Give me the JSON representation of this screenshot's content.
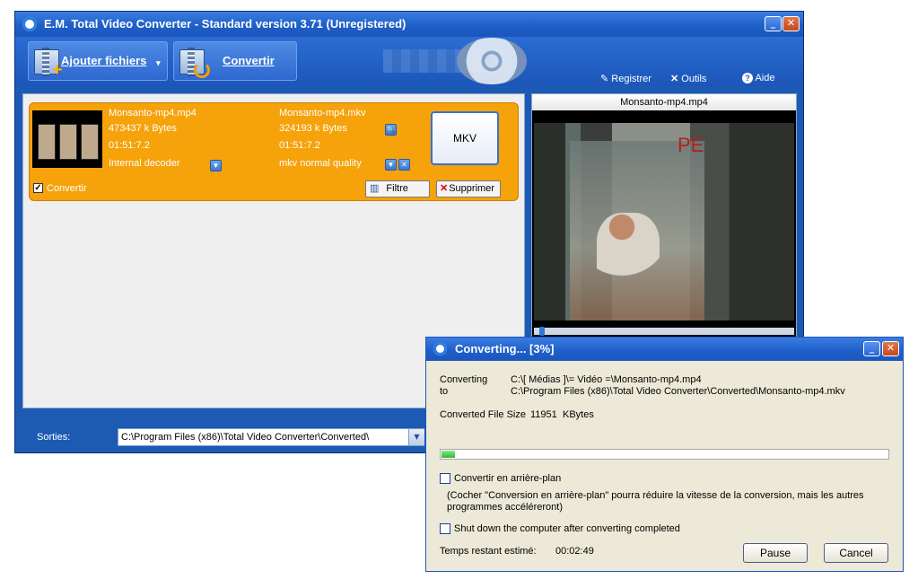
{
  "main_window": {
    "title": "E.M. Total Video Converter -  Standard version 3.71 (Unregistered)",
    "toolbar": {
      "add_files_label": "Ajouter fichiers",
      "add_files_arrow": "▾",
      "convert_label": "Convertir",
      "register_label": "Registrer",
      "tools_label": "Outils",
      "help_label": "Aide"
    },
    "file_item": {
      "source_name": "Monsanto-mp4.mp4",
      "source_size": "473437 k Bytes",
      "source_duration": "01:51:7.2",
      "source_decoder": "Internal decoder",
      "target_name": "Monsanto-mp4.mkv",
      "target_size": "324193 k Bytes",
      "target_duration": "01:51:7.2",
      "target_quality": "mkv normal quality",
      "format_button": "MKV",
      "convert_checkbox": "Convertir",
      "filter_button": "Filtre",
      "delete_button": "Supprimer"
    },
    "preview": {
      "title": "Monsanto-mp4.mp4",
      "frame_text": "PE",
      "position_fraction": 0.02
    },
    "output": {
      "label": "Sorties:",
      "path": "C:\\Program Files (x86)\\Total Video Converter\\Converted\\"
    }
  },
  "converting_dialog": {
    "title": "Converting... [3%]",
    "converting_label": "Converting",
    "to_label": "to",
    "source_path": "C:\\[ Médias ]\\= Vidéo =\\Monsanto-mp4.mp4",
    "target_path": "C:\\Program Files (x86)\\Total Video Converter\\Converted\\Monsanto-mp4.mkv",
    "file_size_label": "Converted File Size",
    "file_size_value": "11951",
    "file_size_unit": "KBytes",
    "progress_percent": 3,
    "background_checkbox": "Convertir en arrière-plan",
    "background_note": "(Cocher \"Conversion en arrière-plan\" pourra réduire la vitesse de la conversion, mais les autres programmes accéléreront)",
    "shutdown_checkbox": "Shut down the computer after converting completed",
    "time_left_label": "Temps restant estimé:",
    "time_left_value": "00:02:49",
    "pause_button": "Pause",
    "cancel_button": "Cancel"
  },
  "colors": {
    "window_blue": "#1d5ab4",
    "item_orange": "#f5a20b",
    "progress_green": "#2fb82f",
    "dialog_bg": "#ece9d8"
  }
}
